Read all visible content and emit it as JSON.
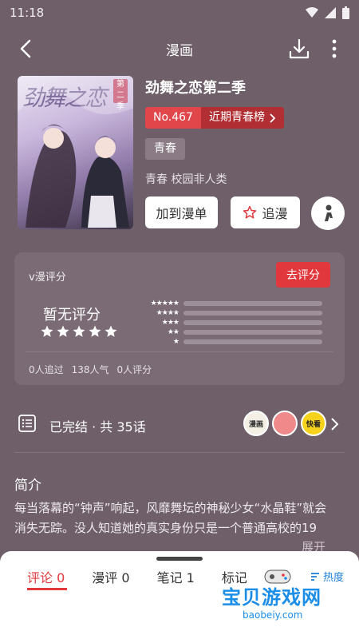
{
  "status_bar": {
    "time": "11:18"
  },
  "header": {
    "title": "漫画"
  },
  "comic": {
    "title": "劲舞之恋第二季",
    "cover_title": "劲舞之恋",
    "cover_badge": "第二季",
    "rank_no": "No.467",
    "rank_list": "近期青春榜",
    "tag": "青春",
    "subtags": "青春 校园非人类"
  },
  "actions": {
    "add_label": "加到漫单",
    "follow_label": "追漫"
  },
  "rating": {
    "label": "v漫评分",
    "rate_button": "去评分",
    "none_text": "暂无评分",
    "distribution": [
      0,
      0,
      0,
      0,
      0
    ],
    "stats": [
      "0人追过",
      "138人气",
      "0人评分"
    ]
  },
  "episodes": {
    "text": "已完结 · 共 35话",
    "avatars": [
      "漫画",
      "",
      "快看"
    ]
  },
  "intro": {
    "heading": "简介",
    "text": "每当落幕的“钟声”响起，风靡舞坛的神秘少女“水晶鞋”就会消失无踪。没人知道她的真实身份只是一个普通高校的19",
    "expand": "展开"
  },
  "bottom_tabs": {
    "tabs": [
      "评论 0",
      "漫评 0",
      "笔记 1",
      "标记"
    ],
    "sort_label": "热度"
  },
  "watermark": {
    "main": "宝贝游戏网",
    "sub": "baobeiy.com"
  }
}
